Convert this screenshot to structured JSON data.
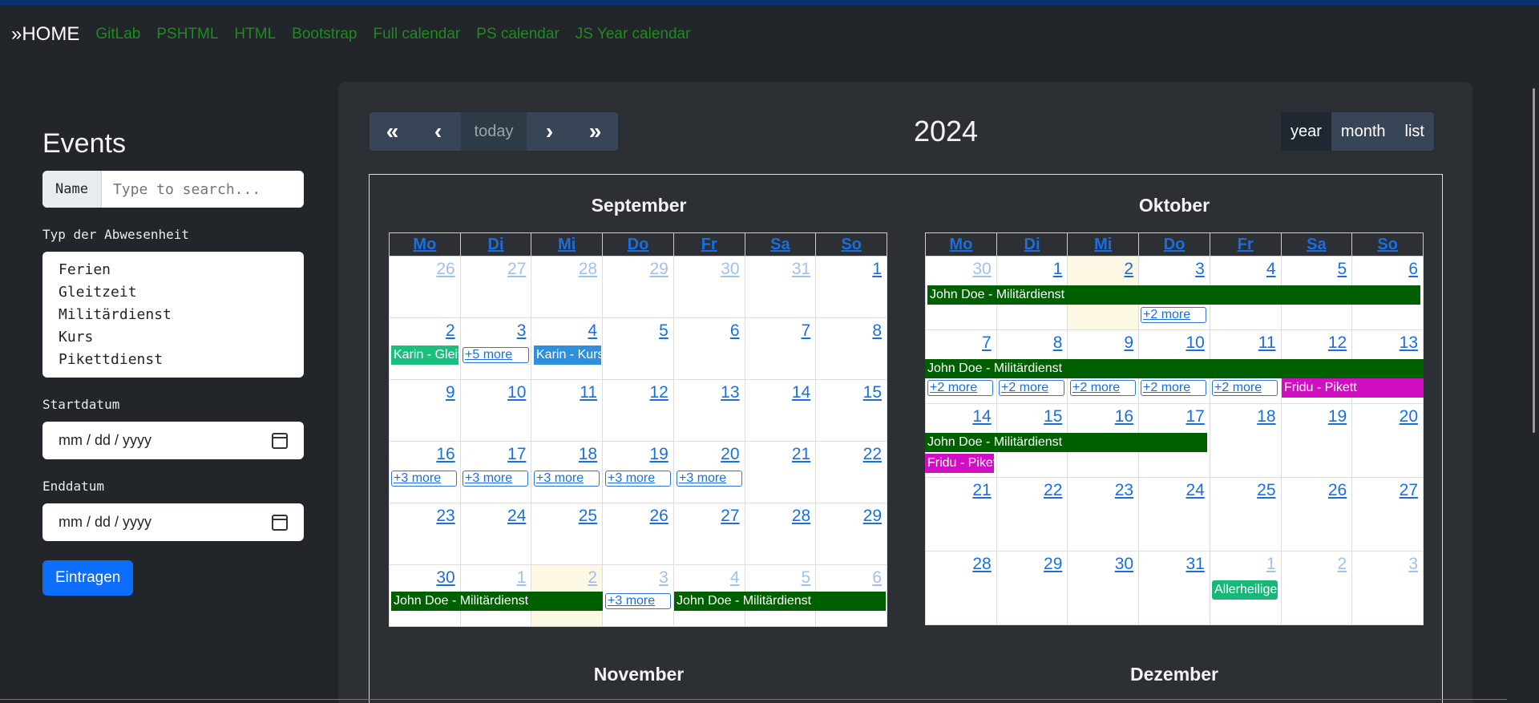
{
  "nav": {
    "brand": "»HOME",
    "links": [
      "GitLab",
      "PSHTML",
      "HTML",
      "Bootstrap",
      "Full calendar",
      "PS calendar",
      "JS Year calendar"
    ]
  },
  "sidebar": {
    "title": "Events",
    "name_label": "Name",
    "name_placeholder": "Type to search...",
    "type_label": "Typ der Abwesenheit",
    "type_options": [
      "Ferien",
      "Gleitzeit",
      "Militärdienst",
      "Kurs",
      "Pikettdienst"
    ],
    "start_label": "Startdatum",
    "start_value": "mm / dd / yyyy",
    "end_label": "Enddatum",
    "end_value": "mm / dd / yyyy",
    "submit_label": "Eintragen"
  },
  "toolbar": {
    "prev_year": "«",
    "prev": "‹",
    "today": "today",
    "next": "›",
    "next_year": "»",
    "title": "2024",
    "views": [
      "year",
      "month",
      "list"
    ],
    "active_view": "year"
  },
  "weekdays": [
    "Mo",
    "Di",
    "Mi",
    "Do",
    "Fr",
    "Sa",
    "So"
  ],
  "months": [
    {
      "name": "September",
      "weeks": [
        [
          "26",
          "27",
          "28",
          "29",
          "30",
          "31",
          "1"
        ],
        [
          "2",
          "3",
          "4",
          "5",
          "6",
          "7",
          "8"
        ],
        [
          "9",
          "10",
          "11",
          "12",
          "13",
          "14",
          "15"
        ],
        [
          "16",
          "17",
          "18",
          "19",
          "20",
          "21",
          "22"
        ],
        [
          "23",
          "24",
          "25",
          "26",
          "27",
          "28",
          "29"
        ],
        [
          "30",
          "1",
          "2",
          "3",
          "4",
          "5",
          "6"
        ]
      ]
    },
    {
      "name": "Oktober",
      "weeks": [
        [
          "30",
          "1",
          "2",
          "3",
          "4",
          "5",
          "6"
        ],
        [
          "7",
          "8",
          "9",
          "10",
          "11",
          "12",
          "13"
        ],
        [
          "14",
          "15",
          "16",
          "17",
          "18",
          "19",
          "20"
        ],
        [
          "21",
          "22",
          "23",
          "24",
          "25",
          "26",
          "27"
        ],
        [
          "28",
          "29",
          "30",
          "31",
          "1",
          "2",
          "3"
        ]
      ]
    }
  ],
  "lower_months": [
    "November",
    "Dezember"
  ],
  "events": {
    "sep_karin_gleitzeit": "Karin - Gleitzeit",
    "sep_karin_kurs": "Karin - Kurs",
    "sep_more_5": "+5 more",
    "more_3": "+3 more",
    "more_2": "+2 more",
    "jd_mil": "John Doe - Militärdienst",
    "fridu_pikett": "Fridu - Pikett",
    "fridu_pike": "Fridu - Pikettdienst",
    "allerheiligen": "Allerheiligen"
  },
  "colors": {
    "militaerdienst": "#006000",
    "gleitzeit": "#1bbf80",
    "kurs": "#2f8fde",
    "pikett": "#d10fc2",
    "link": "#1a6fe0",
    "today_bg": "#fcf8e3"
  }
}
